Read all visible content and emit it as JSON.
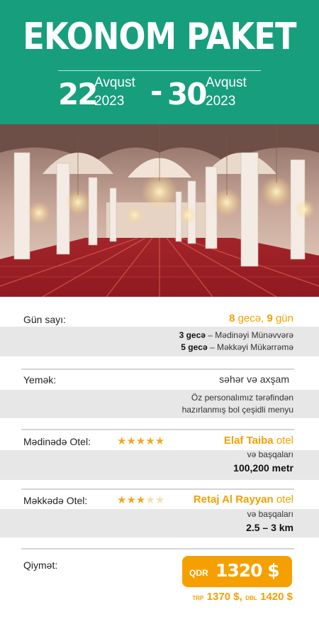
{
  "header": {
    "title": "EKONOM PAKET",
    "start_day": "22",
    "start_month": "Avqust",
    "start_year": "2023",
    "separator": "-",
    "end_day": "30",
    "end_month": "Avqust",
    "end_year": "2023"
  },
  "details": {
    "days": {
      "label": "Gün sayı:",
      "nights": "8",
      "nights_word": "gecə,",
      "days": "9",
      "days_word": "gün",
      "line1_bold": "3 gecə",
      "line1_rest": " – Mədinəyi Münəvvərə",
      "line2_bold": "5 gecə",
      "line2_rest": " – Məkkəyi Mükərrəmə"
    },
    "food": {
      "label": "Yemək:",
      "value": "səhər və axşam",
      "note_line1": "Öz personalımız tərəfindən",
      "note_line2": "hazırlanmış bol çeşidli menyu"
    },
    "medina_hotel": {
      "label": "Mədinədə Otel:",
      "stars_total": 5,
      "stars_filled": 5,
      "name": "Elaf Taiba",
      "name_suffix": "otel",
      "others": "və başqaları",
      "distance": "100,200 metr"
    },
    "mecca_hotel": {
      "label": "Məkkədə Otel:",
      "stars_total": 5,
      "stars_filled": 3,
      "name": "Retaj Al Rayyan",
      "name_suffix": "otel",
      "others": "və başqaları",
      "distance": "2.5 – 3 km"
    },
    "price": {
      "label": "Qiymət:",
      "qdr_label": "QDR",
      "qdr_value": "1320 $",
      "trp_label": "TRP",
      "trp_value": "1370 $,",
      "dbl_label": "DBL",
      "dbl_value": "1420 $"
    }
  },
  "colors": {
    "header_green": "#179e7d",
    "accent_orange": "#f5a000",
    "row_grey": "#e7e7e7"
  }
}
